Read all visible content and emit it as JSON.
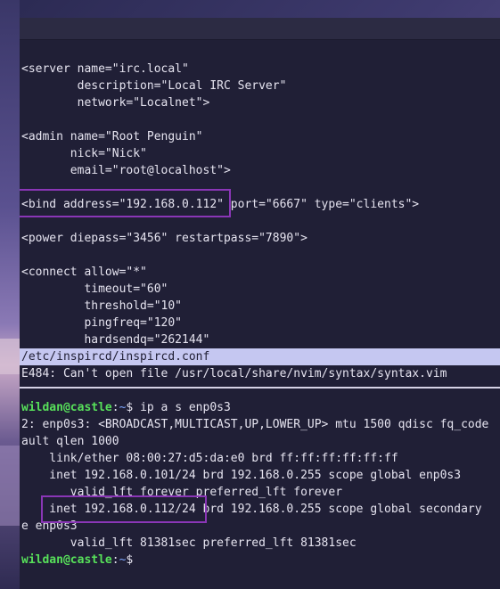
{
  "editor": {
    "lines": [
      "<server name=\"irc.local\"",
      "        description=\"Local IRC Server\"",
      "        network=\"Localnet\">",
      "",
      "<admin name=\"Root Penguin\"",
      "       nick=\"Nick\"",
      "       email=\"root@localhost\">",
      "",
      "<bind address=\"192.168.0.112\" port=\"6667\" type=\"clients\">",
      "",
      "<power diepass=\"3456\" restartpass=\"7890\">",
      "",
      "<connect allow=\"*\"",
      "         timeout=\"60\"",
      "         threshold=\"10\"",
      "         pingfreq=\"120\"",
      "         hardsendq=\"262144\""
    ],
    "status_filename": "/etc/inspircd/inspircd.conf",
    "error_message": "E484: Can't open file /usr/local/share/nvim/syntax/syntax.vim"
  },
  "terminal": {
    "prompt_user": "wildan@castle",
    "prompt_sep": ":",
    "prompt_path": "~",
    "prompt_symbol": "$ ",
    "command": "ip a s enp0s3",
    "output": [
      "2: enp0s3: <BROADCAST,MULTICAST,UP,LOWER_UP> mtu 1500 qdisc fq_code",
      "ault qlen 1000",
      "    link/ether 08:00:27:d5:da:e0 brd ff:ff:ff:ff:ff:ff",
      "    inet 192.168.0.101/24 brd 192.168.0.255 scope global enp0s3",
      "       valid_lft forever preferred_lft forever",
      "    inet 192.168.0.112/24 brd 192.168.0.255 scope global secondary ",
      "e enp0s3",
      "       valid_lft 81381sec preferred_lft 81381sec"
    ]
  },
  "colors": {
    "highlight_box": "#8a36b6",
    "prompt_user": "#57e05a",
    "prompt_path": "#7fa8ff",
    "statusline_bg": "#c5c7f1"
  }
}
